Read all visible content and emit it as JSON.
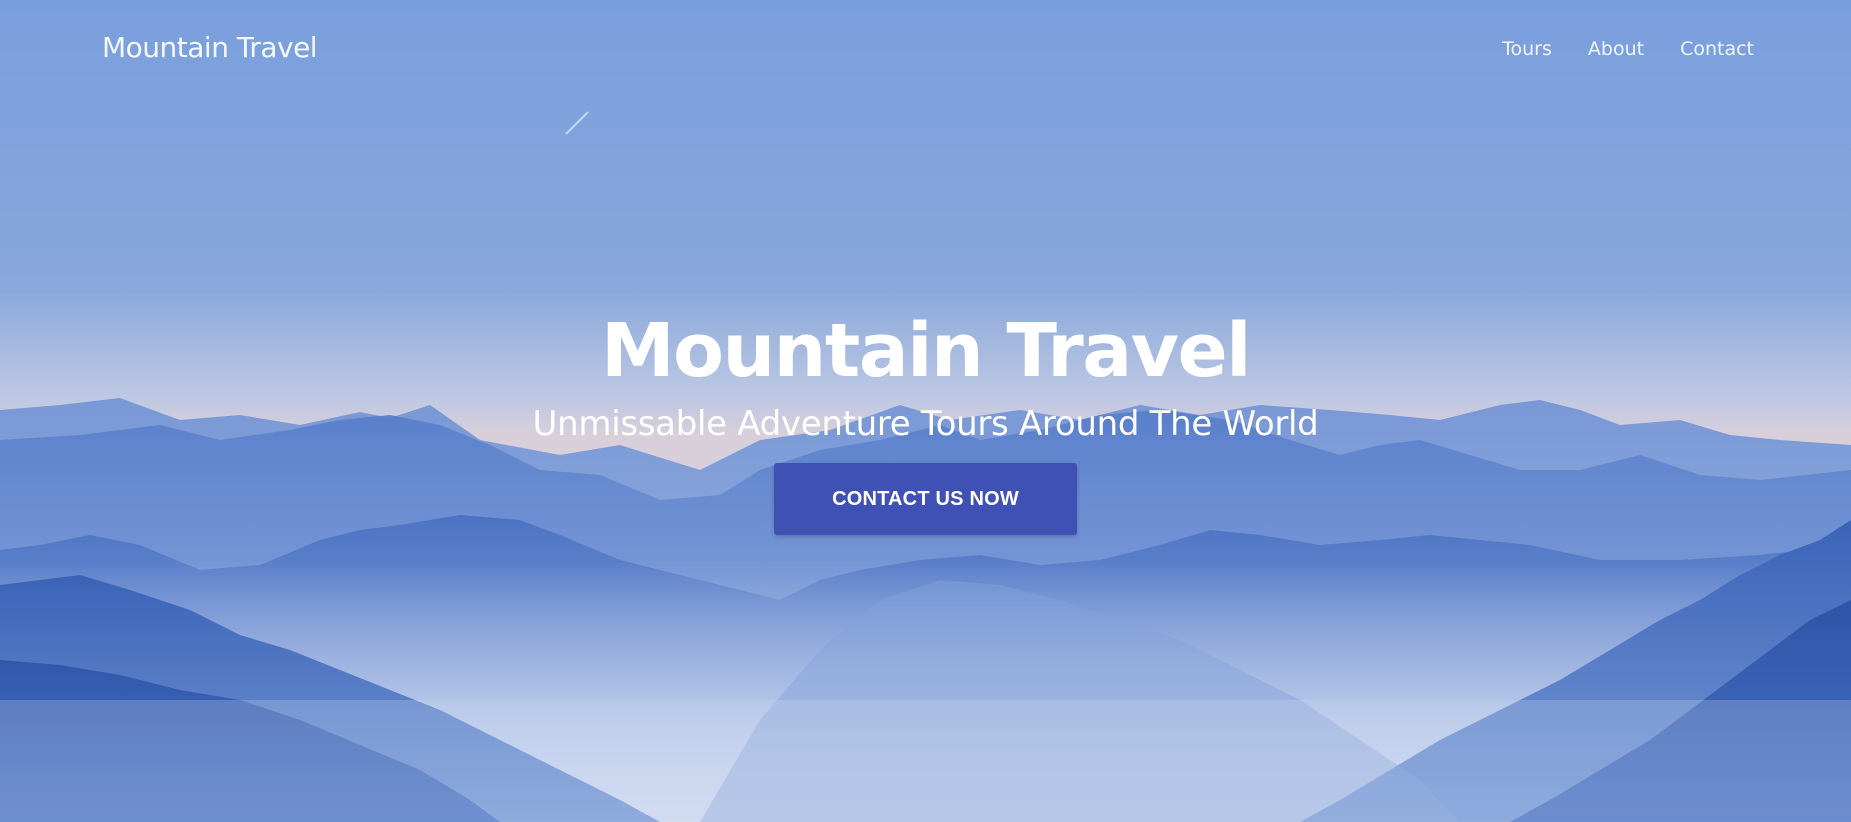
{
  "header": {
    "brand": "Mountain Travel",
    "nav": [
      {
        "label": "Tours"
      },
      {
        "label": "About"
      },
      {
        "label": "Contact"
      }
    ]
  },
  "hero": {
    "title": "Mountain Travel",
    "subtitle": "Unmissable Adventure Tours Around The World",
    "cta_label": "CONTACT US NOW",
    "background": "misty-blue-mountain-range-photo"
  },
  "colors": {
    "cta_background": "#3f51b5",
    "sky_top": "#7fa3df",
    "mountain_dark": "#2d56a6",
    "text": "#ffffff"
  }
}
